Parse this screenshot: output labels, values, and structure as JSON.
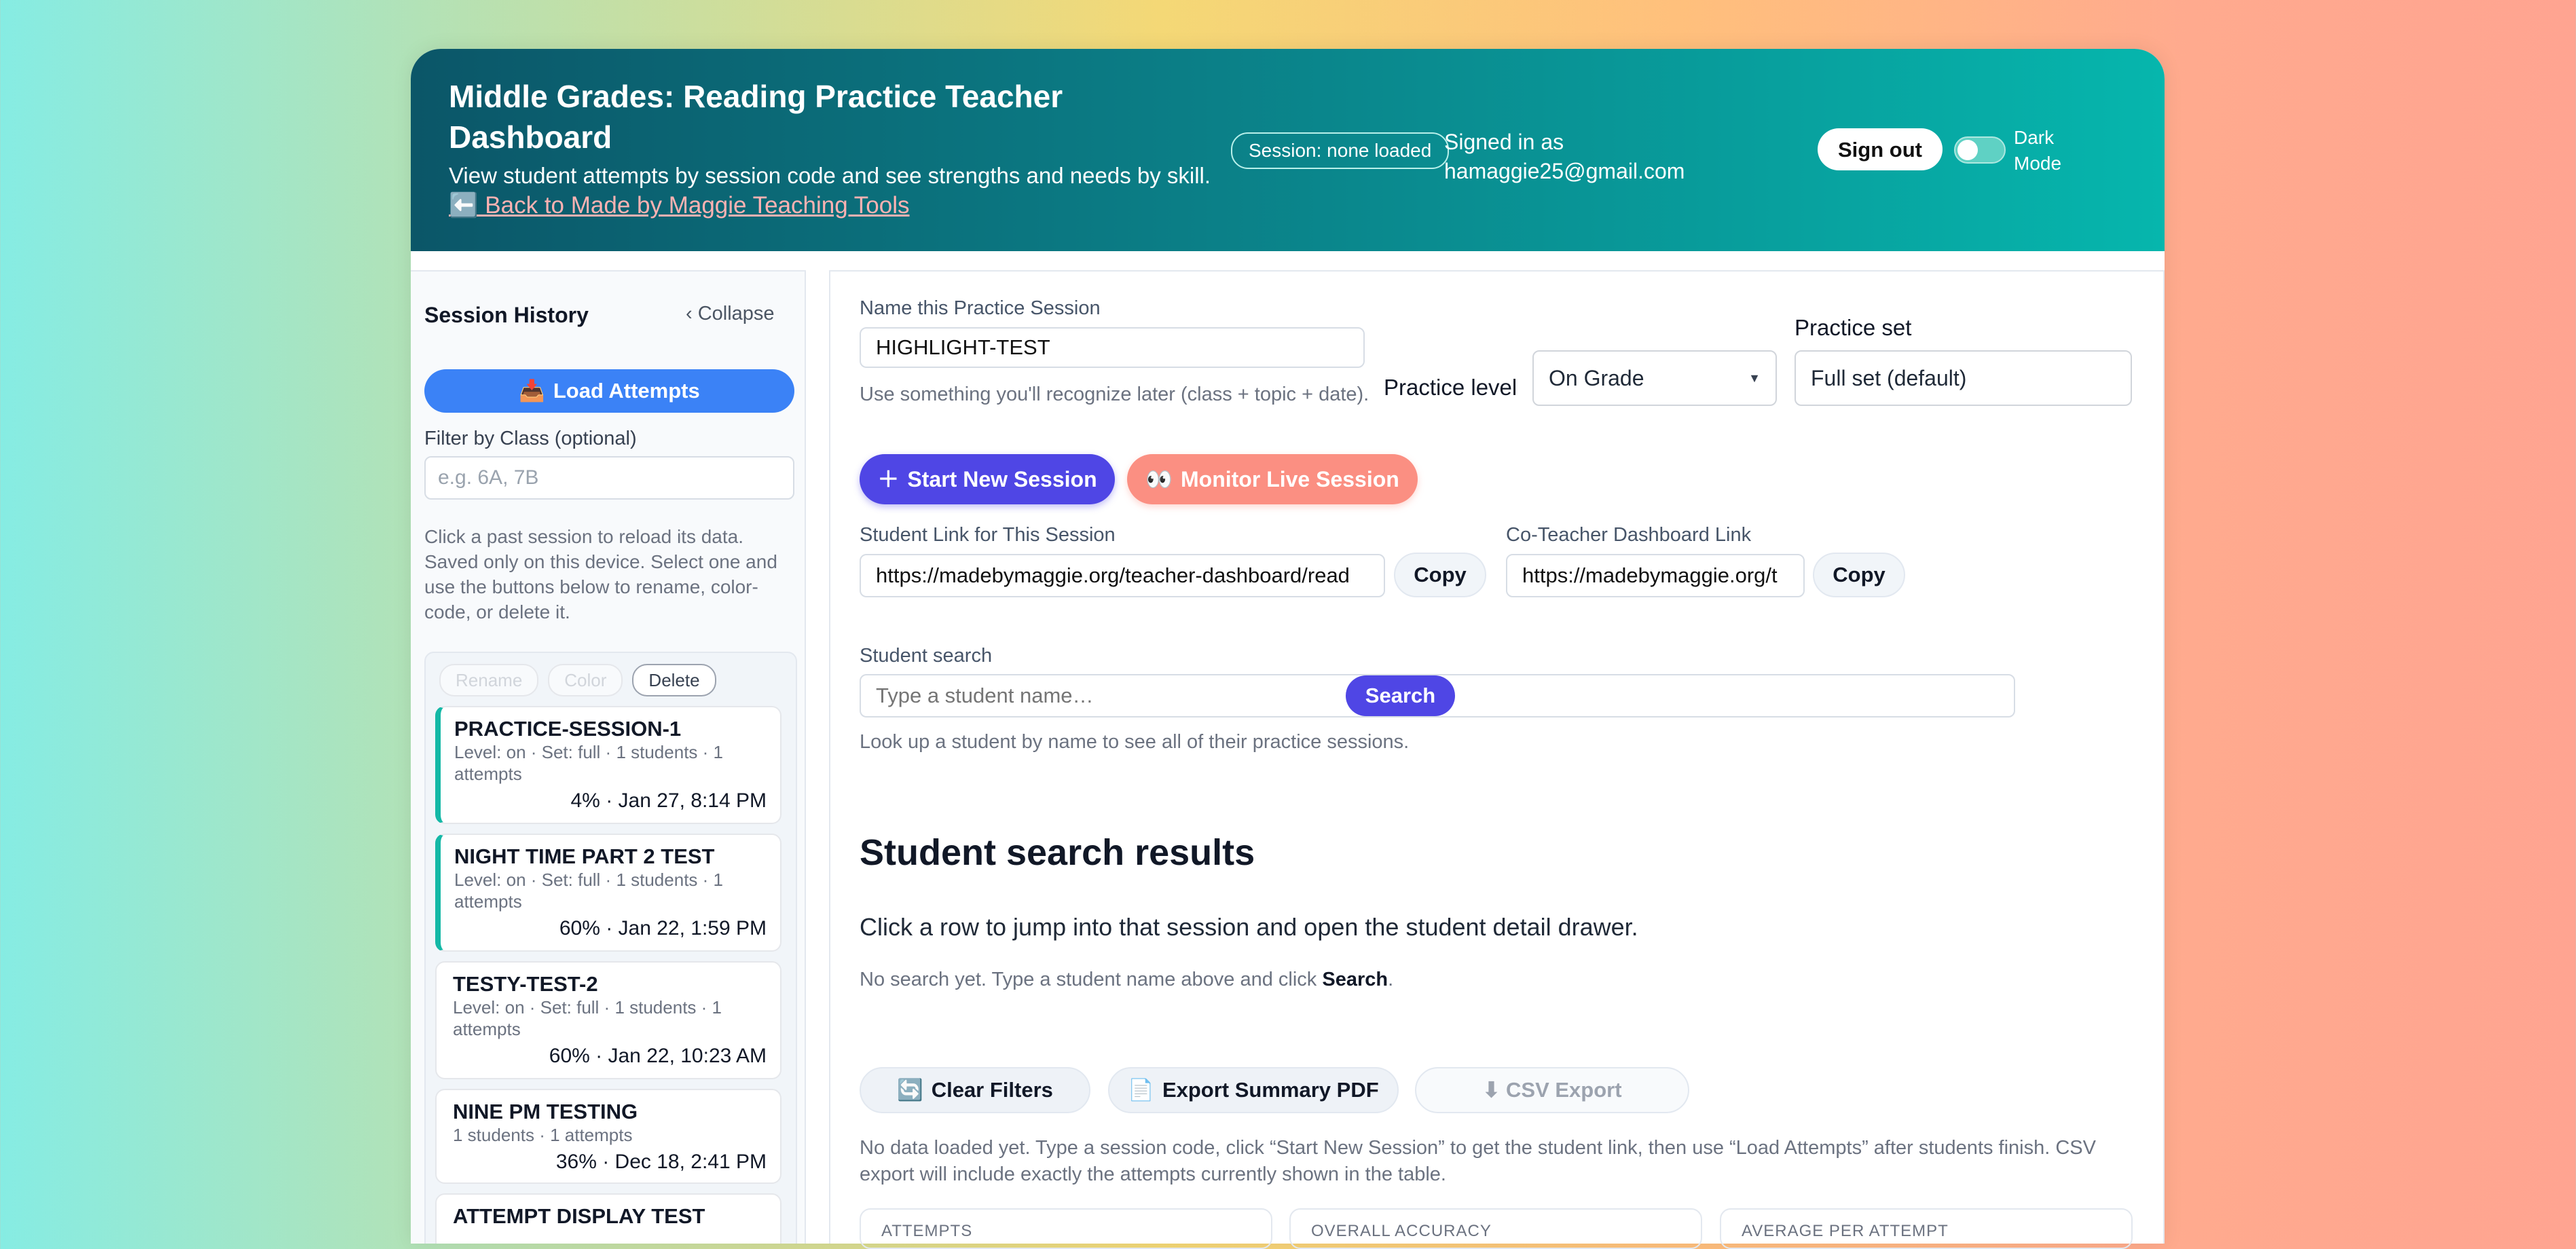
{
  "header": {
    "title": "Middle Grades: Reading Practice Teacher Dashboard",
    "subtitle": "View student attempts by session code and see strengths and needs by skill.",
    "back_link": "⬅️ Back to Made by Maggie Teaching Tools",
    "session_pill": "Session: none loaded",
    "signed_in_label": "Signed in as",
    "signed_in_email": "hamaggie25@gmail.com",
    "sign_out": "Sign out",
    "dark_mode": "Dark Mode"
  },
  "sidebar": {
    "title": "Session History",
    "collapse": "Collapse",
    "load_button": "Load Attempts",
    "filter_label": "Filter by Class (optional)",
    "filter_placeholder": "e.g. 6A, 7B",
    "help": "Click a past session to reload its data. Saved only on this device. Select one and use the buttons below to rename, color-code, or delete it.",
    "actions": {
      "rename": "Rename",
      "color": "Color",
      "delete": "Delete"
    },
    "sessions": [
      {
        "name": "PRACTICE-SESSION-1",
        "meta": "Level: on · Set: full · 1 students · 1 attempts",
        "date": "4% · Jan 27, 8:14 PM"
      },
      {
        "name": "NIGHT TIME PART 2 TEST",
        "meta": "Level: on · Set: full · 1 students · 1 attempts",
        "date": "60% · Jan 22, 1:59 PM"
      },
      {
        "name": "TESTY-TEST-2",
        "meta": "Level: on · Set: full · 1 students · 1 attempts",
        "date": "60% · Jan 22, 10:23 AM"
      },
      {
        "name": "NINE PM TESTING",
        "meta": "1 students · 1 attempts",
        "date": "36% · Dec 18, 2:41 PM"
      },
      {
        "name": "ATTEMPT DISPLAY TEST",
        "meta": "",
        "date": ""
      }
    ]
  },
  "main": {
    "session_name_label": "Name this Practice Session",
    "session_name_value": "HIGHLIGHT-TEST",
    "session_name_hint": "Use something you'll recognize later (class + topic + date).",
    "practice_level_label": "Practice level",
    "practice_level_value": "On Grade",
    "practice_set_label": "Practice set",
    "practice_set_value": "Full set (default)",
    "start_button": "Start New Session",
    "monitor_button": "Monitor Live Session",
    "student_link_label": "Student Link for This Session",
    "student_link_value": "https://madebymaggie.org/teacher-dashboard/read",
    "coteacher_label": "Co-Teacher Dashboard Link",
    "coteacher_value": "https://madebymaggie.org/t",
    "copy": "Copy",
    "search_label": "Student search",
    "search_placeholder": "Type a student name…",
    "search_button": "Search",
    "search_hint": "Look up a student by name to see all of their practice sessions.",
    "results_title": "Student search results",
    "results_desc": "Click a row to jump into that session and open the student detail drawer.",
    "results_none_prefix": "No search yet. Type a student name above and click ",
    "results_none_bold": "Search",
    "results_none_suffix": ".",
    "clear_filters": "Clear Filters",
    "export_pdf": "Export Summary PDF",
    "csv_export": "⬇ CSV Export",
    "note": "No data loaded yet. Type a session code, click “Start New Session” to get the student link, then use “Load Attempts” after students finish. CSV export will include exactly the attempts currently shown in the table.",
    "stats": [
      "ATTEMPTS",
      "OVERALL ACCURACY",
      "AVERAGE PER ATTEMPT"
    ]
  },
  "colors": {
    "accent": "#4f46e5",
    "teal": "#14b8a6",
    "monitor": "#fb8f82",
    "load": "#3b82f6"
  }
}
